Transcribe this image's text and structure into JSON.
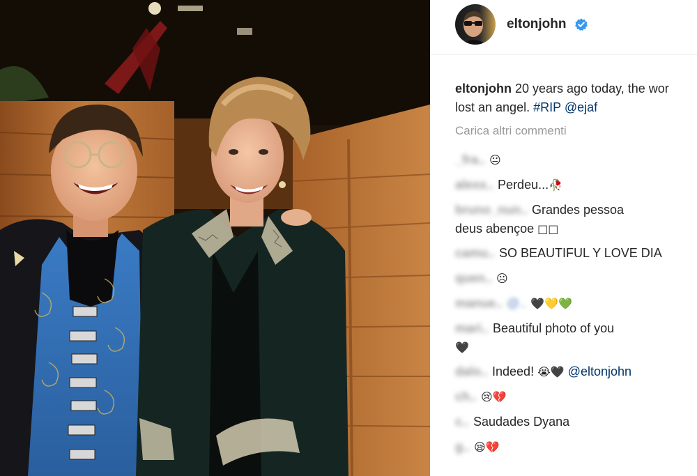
{
  "post": {
    "username": "eltonjohn",
    "verified": true,
    "caption": {
      "author": "eltonjohn",
      "line1": "20 years ago today, the wor",
      "line2_text": "lost an angel.",
      "hashtag": "#RIP",
      "mention": "@ejaf"
    },
    "load_more_label": "Carica altri commenti",
    "comments": [
      {
        "user": "_fra..",
        "text": "",
        "emoji": "😐"
      },
      {
        "user": "alexx..",
        "text": "Perdeu...",
        "emoji": "🥀"
      },
      {
        "user": "bruno_nun..",
        "text": "Grandes pessoa",
        "text2": "deus abençoe",
        "emoji": "□□"
      },
      {
        "user": "camu..",
        "text": "SO BEAUTIFUL Y LOVE DIA",
        "emoji": ""
      },
      {
        "user": "quen..",
        "text": "",
        "emoji": "☹"
      },
      {
        "user": "manue..",
        "mention": "@..",
        "text": "",
        "emoji": "🖤💛💚"
      },
      {
        "user": "mari..",
        "text": "Beautiful photo of you",
        "text2": "",
        "emoji": "🖤"
      },
      {
        "user": "dalo..",
        "text": "Indeed!",
        "mention": "@eltonjohn",
        "emoji": "😭🖤"
      },
      {
        "user": "ch..",
        "text": "",
        "emoji": "😢💔"
      },
      {
        "user": "c..",
        "text": "Saudades Dyana",
        "emoji": ""
      },
      {
        "user": "g..",
        "text": "",
        "emoji": "😪💔"
      }
    ]
  },
  "colors": {
    "text": "#262626",
    "link": "#003569",
    "muted": "#999999",
    "verified": "#3897f0",
    "wood": "#b56d32",
    "jacket": "#1a2d2a",
    "vest": "#2f6db5"
  },
  "icons": {
    "verified": "verified-badge-icon"
  }
}
